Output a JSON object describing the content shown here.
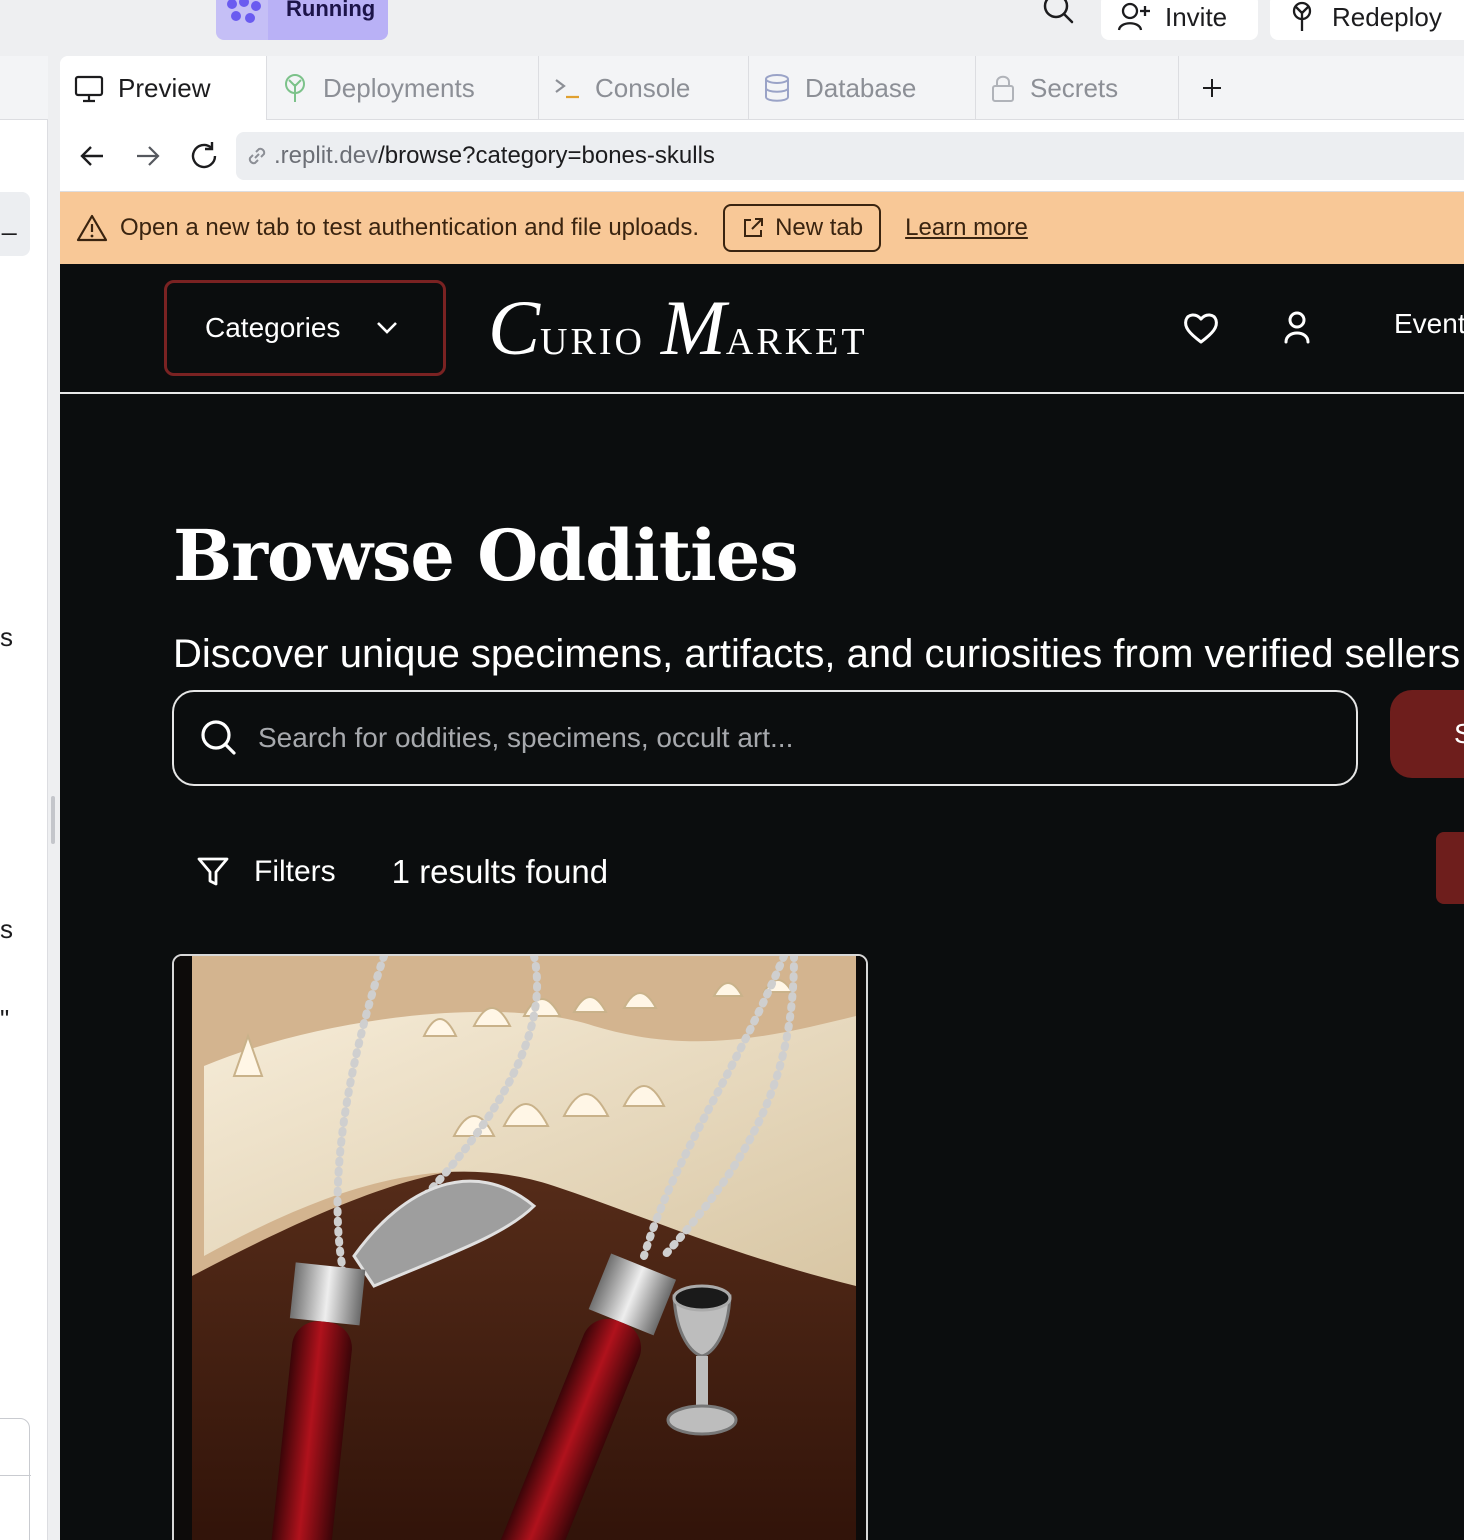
{
  "replit": {
    "run_status": "Running",
    "invite_label": "Invite",
    "redeploy_label": "Redeploy",
    "tabs": [
      {
        "label": "Preview",
        "icon": "monitor-icon"
      },
      {
        "label": "Deployments",
        "icon": "deployments-icon"
      },
      {
        "label": "Console",
        "icon": "terminal-icon"
      },
      {
        "label": "Database",
        "icon": "database-icon"
      },
      {
        "label": "Secrets",
        "icon": "lock-icon"
      }
    ],
    "url": {
      "host": ".replit.dev",
      "path": "/browse?category=bones-skulls"
    },
    "warning": {
      "message": "Open a new tab to test authentication and file uploads.",
      "new_tab_label": "New tab",
      "learn_more_label": "Learn more"
    },
    "left_strip_glyphs": [
      "_",
      "s",
      "s",
      "\""
    ]
  },
  "app": {
    "categories_label": "Categories",
    "logo": {
      "c": "C",
      "urio": "URIO",
      "m": "M",
      "arket": "ARKET"
    },
    "events_label": "Events",
    "title": "Browse Oddities",
    "subtitle": "Discover unique specimens, artifacts, and curiosities from verified sellers",
    "search": {
      "placeholder": "Search for oddities, specimens, occult art...",
      "submit_label": "Search"
    },
    "filters_label": "Filters",
    "results_text": "1 results found",
    "listing_image": "vial-pendants-on-jaw-bone-photo"
  },
  "colors": {
    "running_pill": "#b9b1f6",
    "warning_bg": "#f8c897",
    "app_bg": "#0b0d0e",
    "accent_red": "#6e1e1c",
    "category_border": "#7a2222"
  }
}
